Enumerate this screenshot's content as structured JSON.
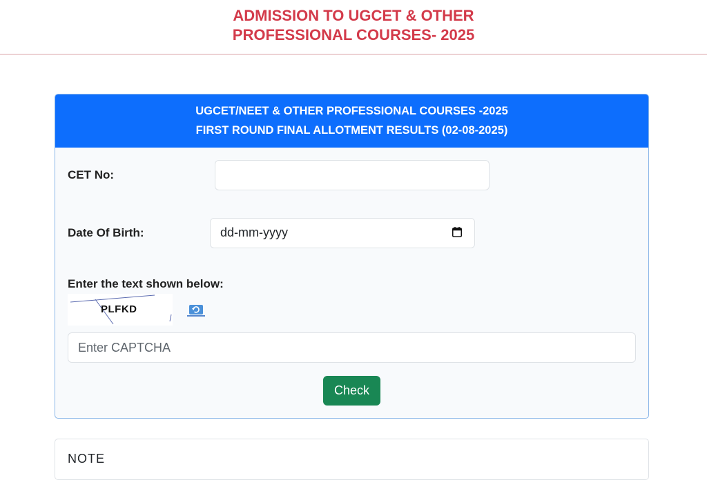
{
  "header": {
    "title_line1": "ADMISSION TO UGCET & OTHER",
    "title_line2": "PROFESSIONAL COURSES- 2025"
  },
  "form": {
    "header_line1": "UGCET/NEET & OTHER PROFESSIONAL COURSES -2025",
    "header_line2": "FIRST ROUND FINAL ALLOTMENT RESULTS (02-08-2025)",
    "cet_label": "CET No:",
    "cet_value": "",
    "dob_label": "Date Of Birth:",
    "dob_placeholder": "dd-mm-yyyy",
    "captcha_label": "Enter the text shown below:",
    "captcha_text": "PLFKD",
    "captcha_placeholder": "Enter CAPTCHA",
    "check_label": "Check"
  },
  "note": {
    "title": "NOTE"
  },
  "colors": {
    "title_red": "#d33a4a",
    "header_blue": "#0d6efd",
    "button_green": "#198754"
  },
  "icons": {
    "calendar": "calendar-icon",
    "refresh": "refresh-icon"
  }
}
